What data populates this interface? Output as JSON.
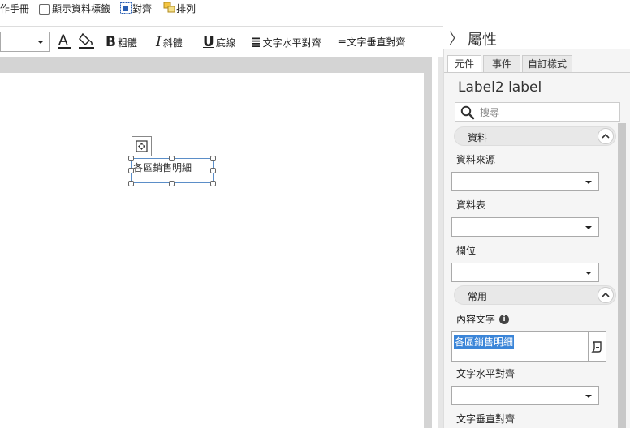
{
  "topbar": {
    "manual": "作手冊",
    "show_data_tags": "顯示資料標籤",
    "align": "對齊",
    "arrange": "排列"
  },
  "format_toolbar": {
    "font_size_value": "",
    "font_color_glyph": "A",
    "bold_glyph": "B",
    "bold": "粗體",
    "italic_glyph": "I",
    "italic": "斜體",
    "underline_glyph": "U",
    "underline": "底線",
    "h_align_glyph": "≣",
    "h_align": "文字水平對齊",
    "v_align_glyph": "═",
    "v_align": "文字垂直對齊"
  },
  "canvas": {
    "label_text": "各區銷售明細"
  },
  "panel": {
    "header": "屬性",
    "tabs": [
      "元件",
      "事件",
      "自訂樣式"
    ],
    "title": "Label2 label",
    "search_placeholder": "搜尋",
    "sections": {
      "data": "資料",
      "common": "常用"
    },
    "fields": {
      "data_source": "資料來源",
      "data_table": "資料表",
      "field": "欄位",
      "content_text": "內容文字",
      "text_h_align": "文字水平對齊",
      "text_v_align": "文字垂直對齊"
    },
    "content_text_value": "各區銷售明細"
  },
  "colors": {
    "selection": "#3b85d8",
    "handle_border": "#5b8ec8"
  }
}
